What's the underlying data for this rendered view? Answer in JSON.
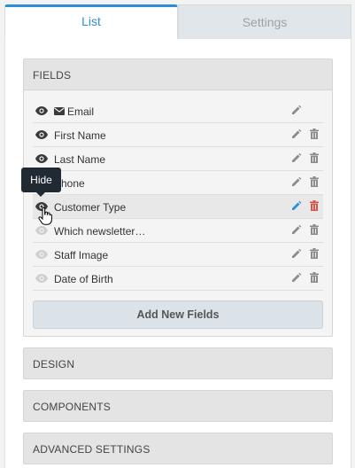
{
  "tabs": [
    {
      "label": "List",
      "active": true
    },
    {
      "label": "Settings",
      "active": false
    }
  ],
  "fields_section": {
    "title": "FIELDS",
    "items": [
      {
        "label": "Email",
        "visible": true,
        "deletable": false,
        "icon": "envelope-icon"
      },
      {
        "label": "First Name",
        "visible": true,
        "deletable": true
      },
      {
        "label": "Last Name",
        "visible": true,
        "deletable": true
      },
      {
        "label": "Phone",
        "visible": true,
        "deletable": true
      },
      {
        "label": "Customer Type",
        "visible": true,
        "deletable": true,
        "hovered": true
      },
      {
        "label": "Which newsletter…",
        "visible": false,
        "deletable": true
      },
      {
        "label": "Staff Image",
        "visible": false,
        "deletable": true
      },
      {
        "label": "Date of Birth",
        "visible": false,
        "deletable": true
      }
    ],
    "add_button": "Add New Fields"
  },
  "sections": [
    {
      "title": "DESIGN"
    },
    {
      "title": "COMPONENTS"
    },
    {
      "title": "ADVANCED SETTINGS"
    }
  ],
  "tooltip": "Hide",
  "colors": {
    "accent": "#2b8fd6",
    "danger": "#d9534f",
    "tooltip_bg": "#202a33"
  }
}
